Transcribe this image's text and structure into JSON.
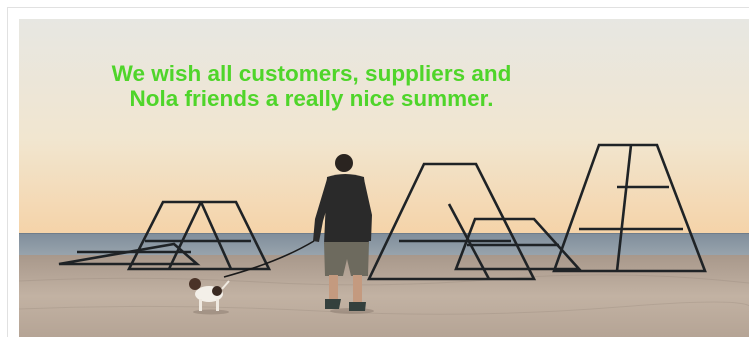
{
  "banner": {
    "greeting_line_1": "We wish all customers, suppliers and",
    "greeting_line_2": "Nola friends a really nice summer."
  },
  "colors": {
    "greeting_text": "#4fd52a",
    "sky_top": "#e9e8e1",
    "sky_bottom": "#f4d6ae",
    "sea": "#8c9aa8",
    "sand": "#b8a89a",
    "frame_steel": "#1f2326"
  },
  "scene": {
    "subjects": [
      "man-walking",
      "dog-on-leash",
      "steel-A-frame-sculptures"
    ]
  }
}
